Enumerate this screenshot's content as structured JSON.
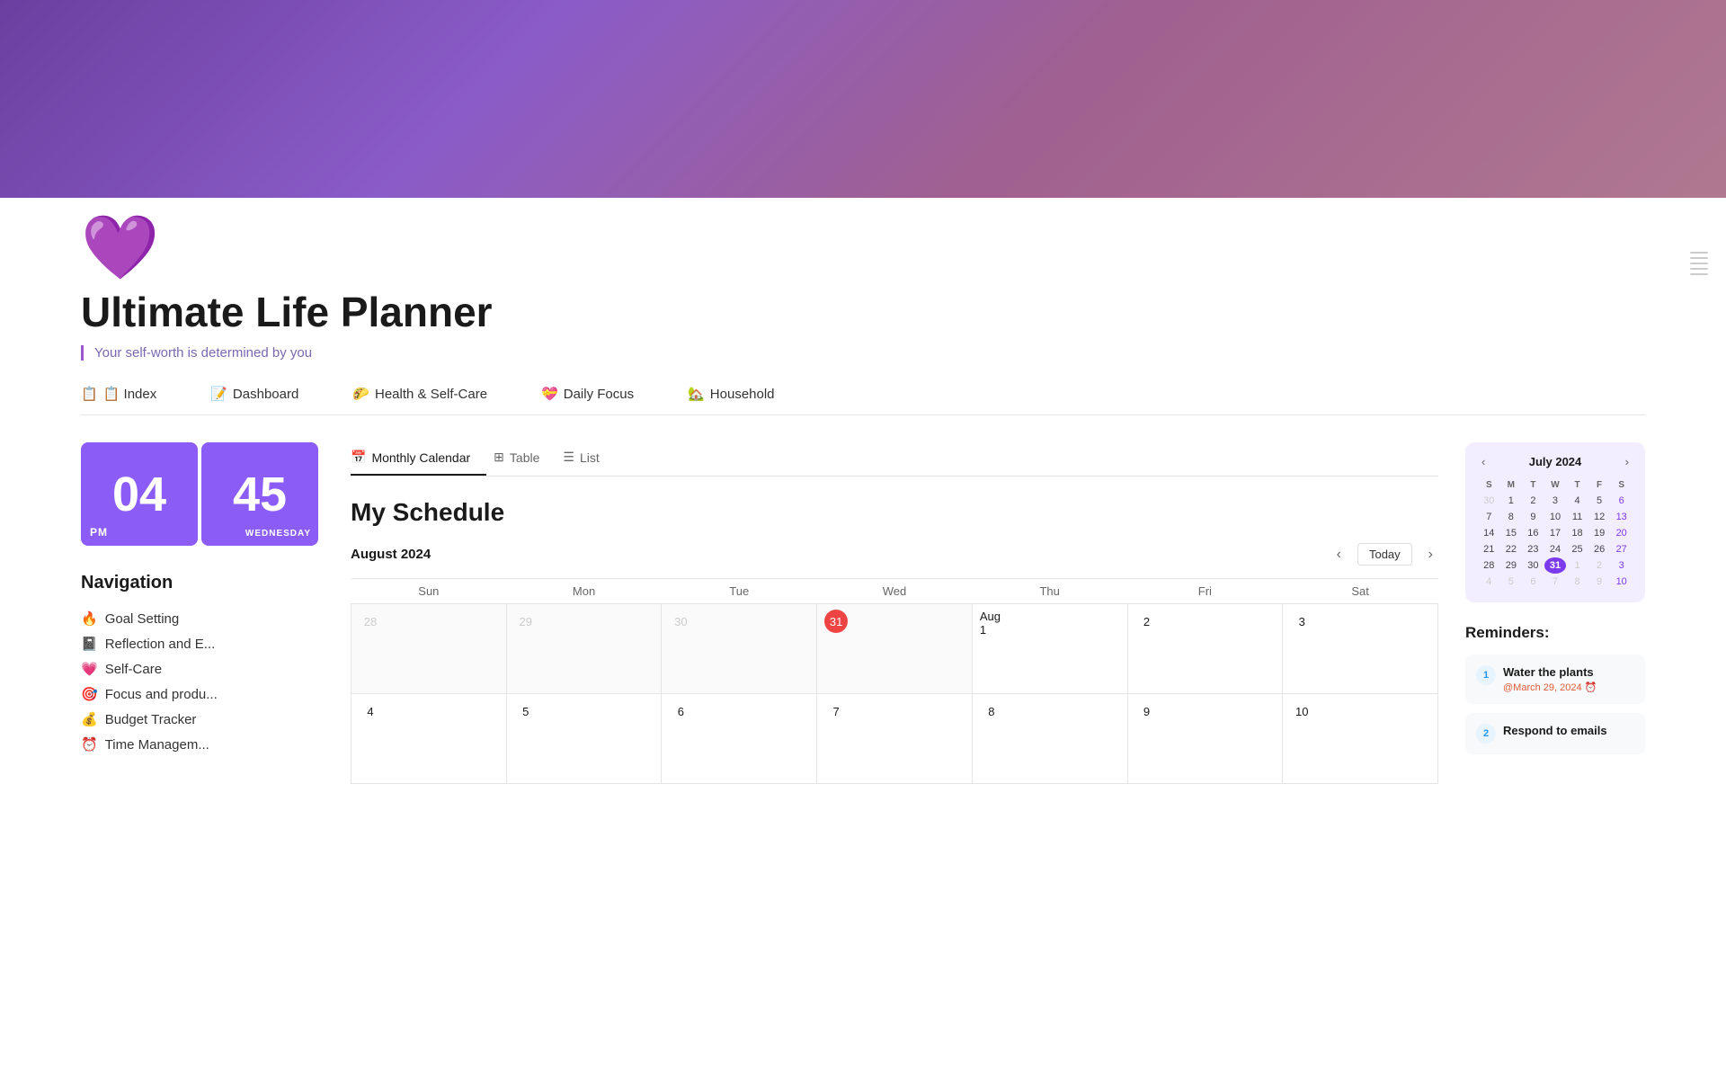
{
  "header": {
    "banner_gradient": "linear-gradient(135deg, #6b3fa0, #a06090)",
    "heart_emoji": "💜",
    "title": "Ultimate Life Planner",
    "subtitle": "Your self-worth is determined by you"
  },
  "top_nav": {
    "items": [
      {
        "label": "📋 Index",
        "id": "index"
      },
      {
        "label": "📝 Dashboard",
        "id": "dashboard"
      },
      {
        "label": "🌮 Health & Self-Care",
        "id": "health"
      },
      {
        "label": "💝 Daily Focus",
        "id": "daily-focus"
      },
      {
        "label": "🏡 Household",
        "id": "household"
      }
    ]
  },
  "clock": {
    "hour": "04",
    "minute": "45",
    "period": "PM",
    "day": "WEDNESDAY"
  },
  "navigation": {
    "title": "Navigation",
    "items": [
      {
        "emoji": "🔥",
        "label": "Goal Setting"
      },
      {
        "emoji": "📓",
        "label": "Reflection and E..."
      },
      {
        "emoji": "💗",
        "label": "Self-Care"
      },
      {
        "emoji": "🎯",
        "label": "Focus and produ..."
      },
      {
        "emoji": "💰",
        "label": "Budget Tracker"
      },
      {
        "emoji": "⏰",
        "label": "Time Managem..."
      }
    ]
  },
  "view_tabs": [
    {
      "label": "Monthly Calendar",
      "icon": "📅",
      "active": true
    },
    {
      "label": "Table",
      "icon": "⊞",
      "active": false
    },
    {
      "label": "List",
      "icon": "☰",
      "active": false
    }
  ],
  "schedule": {
    "title": "My Schedule",
    "current_month": "August 2024"
  },
  "calendar": {
    "weekdays": [
      "Sun",
      "Mon",
      "Tue",
      "Wed",
      "Thu",
      "Fri",
      "Sat"
    ],
    "rows": [
      [
        {
          "day": "28",
          "month": "other"
        },
        {
          "day": "29",
          "month": "other"
        },
        {
          "day": "30",
          "month": "other"
        },
        {
          "day": "31",
          "month": "other",
          "today": true
        },
        {
          "day": "Aug 1",
          "month": "current"
        },
        {
          "day": "2",
          "month": "current"
        },
        {
          "day": "3",
          "month": "current"
        }
      ],
      [
        {
          "day": "4",
          "month": "current"
        },
        {
          "day": "5",
          "month": "current"
        },
        {
          "day": "6",
          "month": "current"
        },
        {
          "day": "7",
          "month": "current"
        },
        {
          "day": "8",
          "month": "current"
        },
        {
          "day": "9",
          "month": "current"
        },
        {
          "day": "10",
          "month": "current"
        }
      ]
    ]
  },
  "mini_calendar": {
    "title": "July 2024",
    "weekdays": [
      "S",
      "M",
      "T",
      "W",
      "T",
      "F",
      "S"
    ],
    "rows": [
      [
        {
          "day": "30",
          "other": true
        },
        {
          "day": "1"
        },
        {
          "day": "2"
        },
        {
          "day": "3"
        },
        {
          "day": "4"
        },
        {
          "day": "5"
        },
        {
          "day": "6"
        }
      ],
      [
        {
          "day": "7"
        },
        {
          "day": "8"
        },
        {
          "day": "9"
        },
        {
          "day": "10"
        },
        {
          "day": "11"
        },
        {
          "day": "12"
        },
        {
          "day": "13"
        }
      ],
      [
        {
          "day": "14"
        },
        {
          "day": "15"
        },
        {
          "day": "16"
        },
        {
          "day": "17"
        },
        {
          "day": "18"
        },
        {
          "day": "19"
        },
        {
          "day": "20"
        }
      ],
      [
        {
          "day": "21"
        },
        {
          "day": "22"
        },
        {
          "day": "23"
        },
        {
          "day": "24"
        },
        {
          "day": "25"
        },
        {
          "day": "26"
        },
        {
          "day": "27"
        }
      ],
      [
        {
          "day": "28"
        },
        {
          "day": "29"
        },
        {
          "day": "30"
        },
        {
          "day": "31",
          "today": true
        },
        {
          "day": "1",
          "other": true
        },
        {
          "day": "2",
          "other": true
        },
        {
          "day": "3",
          "other": true
        }
      ],
      [
        {
          "day": "4",
          "other": true
        },
        {
          "day": "5",
          "other": true
        },
        {
          "day": "6",
          "other": true
        },
        {
          "day": "7",
          "other": true
        },
        {
          "day": "8",
          "other": true
        },
        {
          "day": "9",
          "other": true
        },
        {
          "day": "10",
          "other": true
        }
      ]
    ]
  },
  "reminders": {
    "title": "Reminders:",
    "items": [
      {
        "num": "1",
        "text": "Water the plants",
        "date": "@March 29, 2024 ⏰"
      },
      {
        "num": "2",
        "text": "Respond to emails",
        "date": ""
      }
    ]
  }
}
